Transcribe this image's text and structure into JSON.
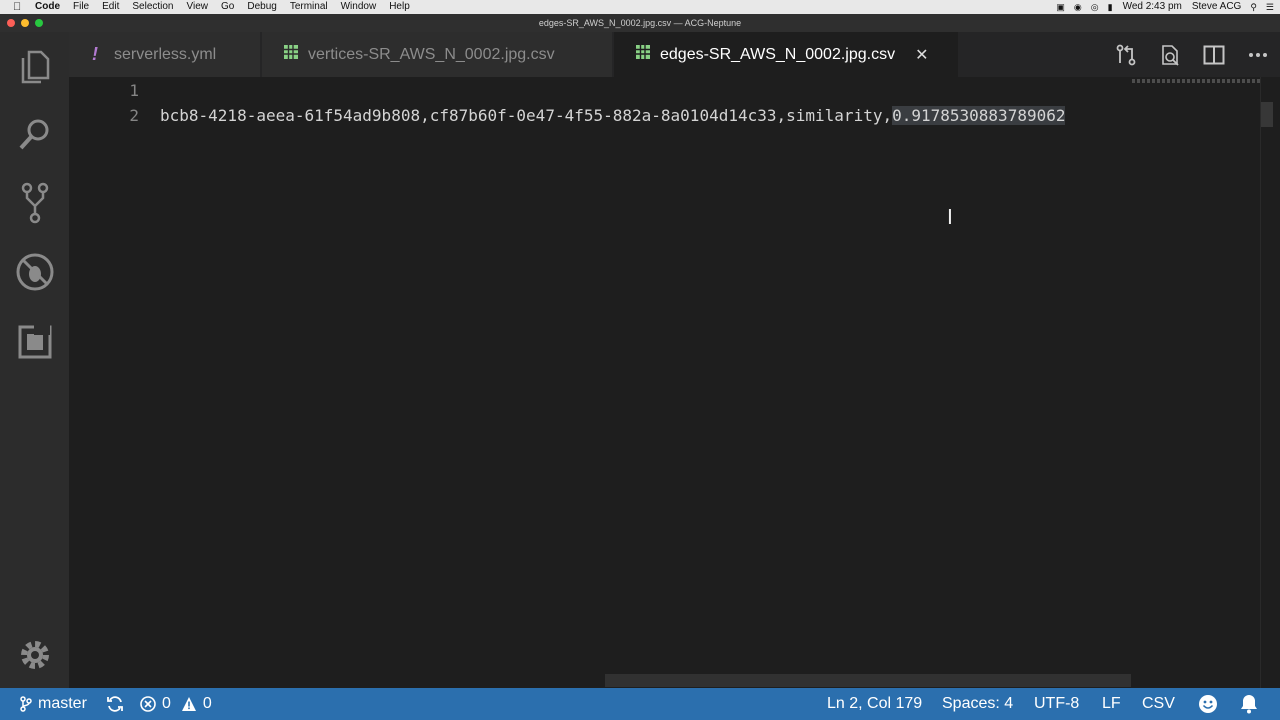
{
  "menubar": {
    "app": "Code",
    "items": [
      "File",
      "Edit",
      "Selection",
      "View",
      "Go",
      "Debug",
      "Terminal",
      "Window",
      "Help"
    ],
    "clock": "Wed 2:43 pm",
    "user": "Steve ACG"
  },
  "window": {
    "title": "edges-SR_AWS_N_0002.jpg.csv — ACG-Neptune"
  },
  "activity_bar": {
    "icons": [
      "files-icon",
      "search-icon",
      "source-control-icon",
      "debug-icon",
      "extensions-icon"
    ],
    "bottom_icon": "gear-icon"
  },
  "tabs": [
    {
      "label": "serverless.yml",
      "icon": "exclamation-icon",
      "active": false
    },
    {
      "label": "vertices-SR_AWS_N_0002.jpg.csv",
      "icon": "table-file-icon",
      "active": false
    },
    {
      "label": "edges-SR_AWS_N_0002.jpg.csv",
      "icon": "table-file-icon",
      "active": true
    }
  ],
  "editor": {
    "line_numbers": [
      "1",
      "2"
    ],
    "line2_text": "bcb8-4218-aeea-61f54ad9b808,cf87b60f-0e47-4f55-882a-8a0104d14c33,similarity,",
    "line2_selected": "0.9178530883789062"
  },
  "statusbar": {
    "branch": "master",
    "errors": "0",
    "warnings": "0",
    "position": "Ln 2, Col 179",
    "spaces": "Spaces: 4",
    "encoding": "UTF-8",
    "eol": "LF",
    "language": "CSV"
  },
  "colors": {
    "statusbar": "#2b6fae",
    "editor_bg": "#1e1e1e",
    "csv_icon": "#89d185",
    "yml_icon": "#b27ad1"
  }
}
